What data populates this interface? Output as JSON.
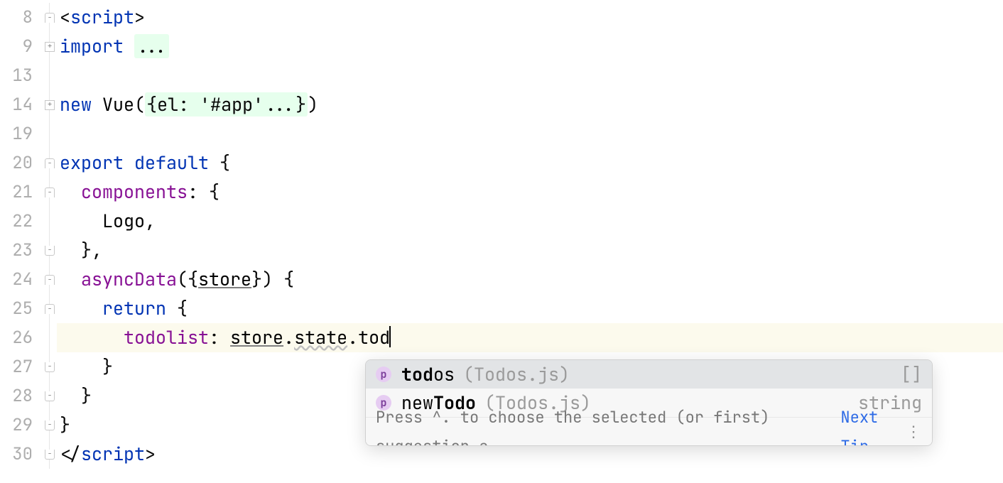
{
  "gutter": {
    "numbers": [
      "8",
      "9",
      "13",
      "14",
      "19",
      "20",
      "21",
      "22",
      "23",
      "24",
      "25",
      "26",
      "27",
      "28",
      "29",
      "30"
    ]
  },
  "fold": {
    "icons": [
      "plus-start",
      "plus",
      "",
      "plus",
      "",
      "minus-start",
      "minus",
      "",
      "minus-end",
      "minus",
      "minus",
      "",
      "minus-end",
      "minus-end",
      "minus-end",
      ""
    ],
    "glyph_plus": "+",
    "glyph_minus": "−"
  },
  "code": {
    "l8": {
      "a": "<",
      "b": "script",
      "c": ">"
    },
    "l9": {
      "a": "import",
      "b": " ",
      "c": "..."
    },
    "l14": {
      "a": "new",
      "sp": " ",
      "b": "Vue",
      "c": "(",
      "d": "{el: '#app'...}",
      "e": ")"
    },
    "l20": {
      "a": "export ",
      "b": "default ",
      "c": "{"
    },
    "l21": {
      "indent": "  ",
      "a": "components",
      "b": ": {"
    },
    "l22": {
      "indent": "    ",
      "a": "Logo",
      "b": ","
    },
    "l23": {
      "indent": "  ",
      "a": "},"
    },
    "l24": {
      "indent": "  ",
      "a": "asyncData",
      "b": "({",
      "c": "store",
      "d": "})",
      "e": " {"
    },
    "l25": {
      "indent": "    ",
      "a": "return",
      "b": " {"
    },
    "l26": {
      "indent": "      ",
      "a": "todolist",
      "b": ": ",
      "c": "store",
      "d": ".",
      "e": "state",
      "f": ".",
      "g": "tod"
    },
    "l27": {
      "indent": "    ",
      "a": "}"
    },
    "l28": {
      "indent": "  ",
      "a": "}"
    },
    "l29": {
      "a": "}"
    },
    "l30": {
      "a": "</",
      "b": "script",
      "c": ">"
    }
  },
  "popup": {
    "items": [
      {
        "badge": "p",
        "prefix": "tod",
        "rest": "os",
        "loc": "(Todos.js)",
        "type": "[]"
      },
      {
        "badge": "p",
        "prefix": "new",
        "rest": "Todo",
        "loc": "(Todos.js)",
        "type": "string"
      }
    ],
    "hint_text": "Press ^. to choose the selected (or first) suggestion a..",
    "hint_link": "Next Tip",
    "more_glyph": "⋮"
  }
}
